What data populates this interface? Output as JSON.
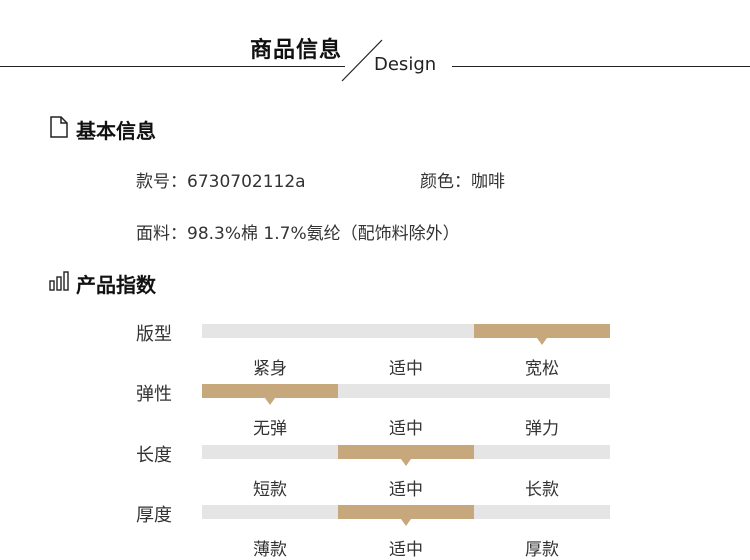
{
  "header": {
    "title": "商品信息",
    "subtitle": "Design"
  },
  "basic": {
    "heading": "基本信息",
    "icon": "document-icon",
    "style_no": "款号：6730702112a",
    "color": "颜色：咖啡",
    "material": "面料：98.3%棉 1.7%氨纶（配饰料除外）"
  },
  "index": {
    "heading": "产品指数",
    "icon": "bar-chart-icon",
    "accent_color": "#c7a87d",
    "track_color": "#e5e5e5",
    "rows": [
      {
        "label": "版型",
        "options": [
          "紧身",
          "适中",
          "宽松"
        ],
        "selected_index": 2
      },
      {
        "label": "弹性",
        "options": [
          "无弹",
          "适中",
          "弹力"
        ],
        "selected_index": 0
      },
      {
        "label": "长度",
        "options": [
          "短款",
          "适中",
          "长款"
        ],
        "selected_index": 1
      },
      {
        "label": "厚度",
        "options": [
          "薄款",
          "适中",
          "厚款"
        ],
        "selected_index": 1
      }
    ]
  }
}
